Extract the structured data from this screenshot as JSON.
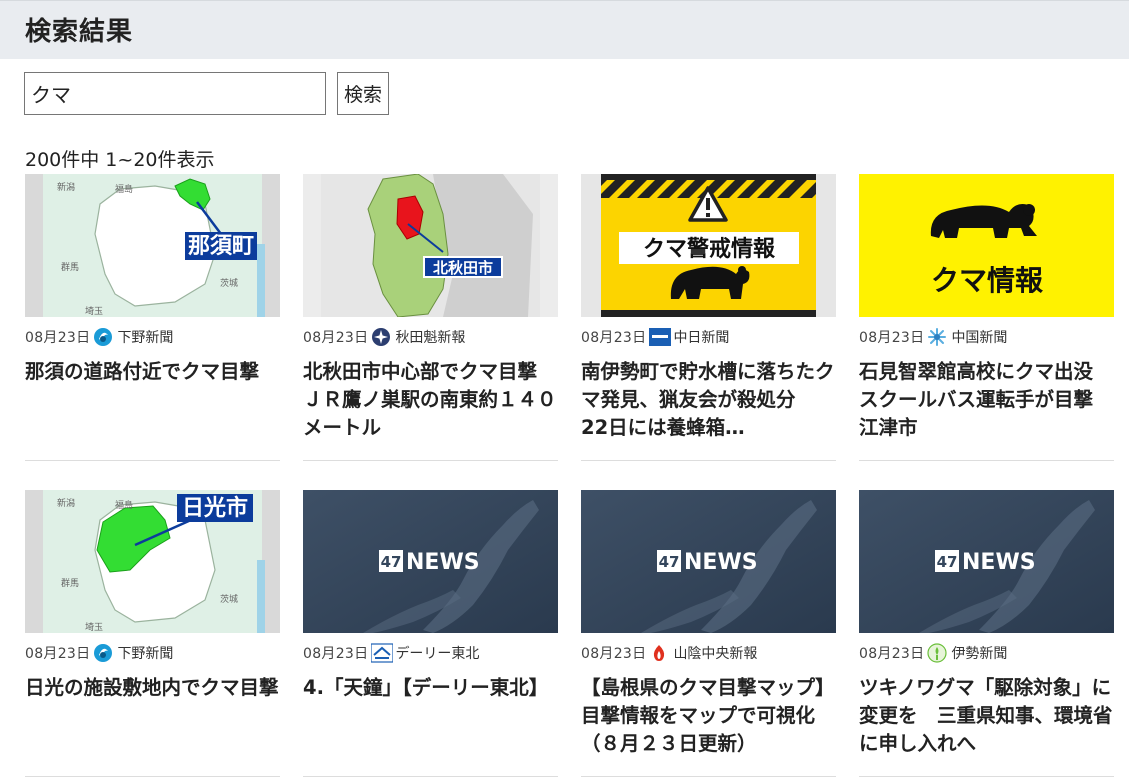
{
  "header": {
    "title": "検索結果"
  },
  "search": {
    "value": "クマ",
    "button_label": "検索"
  },
  "results": {
    "count_text": "200件中 1~20件表示",
    "items": [
      {
        "date": "08月23日",
        "source": "下野新聞",
        "title": "那須の道路付近でクマ目撃",
        "thumb_label": "那須町",
        "thumb_map": {
          "g1": "福島",
          "g2": "新潟",
          "g3": "群馬",
          "g4": "茨城",
          "g5": "埼玉"
        }
      },
      {
        "date": "08月23日",
        "source": "秋田魁新報",
        "title": "北秋田市中心部でクマ目撃　ＪＲ鷹ノ巣駅の南東約１４０メートル",
        "thumb_label": "北秋田市"
      },
      {
        "date": "08月23日",
        "source": "中日新聞",
        "title": "南伊勢町で貯水槽に落ちたクマ発見、猟友会が殺処分　22日には養蜂箱…",
        "thumb_label": "クマ警戒情報"
      },
      {
        "date": "08月23日",
        "source": "中国新聞",
        "title": "石見智翠館高校にクマ出没　スクールバス運転手が目撃　江津市",
        "thumb_label": "クマ情報"
      },
      {
        "date": "08月23日",
        "source": "下野新聞",
        "title": "日光の施設敷地内でクマ目撃",
        "thumb_label": "日光市",
        "thumb_map": {
          "g1": "福島",
          "g2": "新潟",
          "g3": "群馬",
          "g4": "茨城",
          "g5": "埼玉"
        }
      },
      {
        "date": "08月23日",
        "source": "デーリー東北",
        "title": "4.「天鐘」【デーリー東北】",
        "thumb_label": "47NEWS"
      },
      {
        "date": "08月23日",
        "source": "山陰中央新報",
        "title": "【島根県のクマ目撃マップ】目撃情報をマップで可視化（８月２３日更新）",
        "thumb_label": "47NEWS"
      },
      {
        "date": "08月23日",
        "source": "伊勢新聞",
        "title": "ツキノワグマ「駆除対象」に変更を　三重県知事、環境省に申し入れへ",
        "thumb_label": "47NEWS"
      }
    ]
  },
  "colors": {
    "header_bg": "#e9ecf0",
    "caution_yellow": "#fcd400",
    "map_green": "#33dd33",
    "map_red": "#e8141c",
    "label_blue": "#0c3c9c",
    "news_bg": "#34465c"
  }
}
